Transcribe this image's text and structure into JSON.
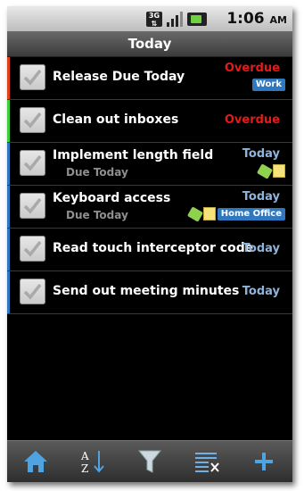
{
  "statusbar": {
    "network": "3G",
    "clock_time": "1:06",
    "clock_ampm": "AM"
  },
  "header": {
    "title": "Today"
  },
  "tasks": [
    {
      "title": "Release Due Today",
      "subtitle": "",
      "status": "Overdue",
      "status_kind": "overdue",
      "context": "Work",
      "stripe_color": "#e0411b",
      "tag": false,
      "note": false
    },
    {
      "title": "Clean out inboxes",
      "subtitle": "",
      "status": "Overdue",
      "status_kind": "overdue",
      "context": "",
      "stripe_color": "#3ccf3c",
      "tag": false,
      "note": false
    },
    {
      "title": "Implement length field",
      "subtitle": "Due Today",
      "status": "Today",
      "status_kind": "today",
      "context": "",
      "stripe_color": "#2f78c0",
      "tag": true,
      "note": true
    },
    {
      "title": "Keyboard access",
      "subtitle": "Due Today",
      "status": "Today",
      "status_kind": "today",
      "context": "Home Office",
      "stripe_color": "#2f78c0",
      "tag": true,
      "note": true
    },
    {
      "title": "Read touch interceptor code",
      "subtitle": "",
      "status": "Today",
      "status_kind": "today",
      "context": "",
      "stripe_color": "#2f78c0",
      "tag": false,
      "note": false
    },
    {
      "title": "Send out meeting minutes",
      "subtitle": "",
      "status": "Today",
      "status_kind": "today",
      "context": "",
      "stripe_color": "#2f78c0",
      "tag": false,
      "note": false
    }
  ],
  "toolbar": {
    "buttons": [
      "home-icon",
      "sort-az-icon",
      "filter-icon",
      "clear-completed-icon",
      "add-icon"
    ],
    "sort_letter_top": "A",
    "sort_letter_bottom": "Z"
  },
  "colors": {
    "overdue": "#e21b1b",
    "today": "#8fb3d9",
    "context_badge": "#2f78c0"
  }
}
